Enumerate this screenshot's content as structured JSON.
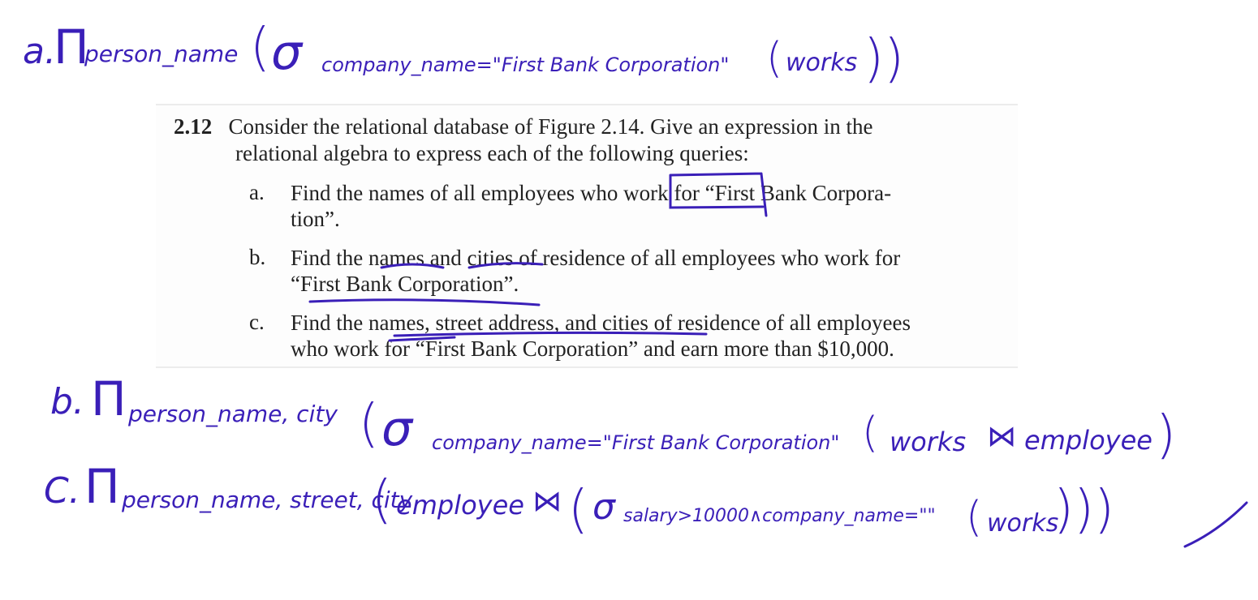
{
  "problem": {
    "number": "2.12",
    "intro_line1": "Consider the relational database of Figure 2.14. Give an expression in the",
    "intro_line2": "relational algebra to express each of the following queries:",
    "items": [
      {
        "letter": "a.",
        "line1": "Find the names of all employees who work for “First Bank Corpora-",
        "line2": "tion”."
      },
      {
        "letter": "b.",
        "line1": "Find the names and cities of residence of all employees who work for",
        "line2": "“First Bank Corporation”."
      },
      {
        "letter": "c.",
        "line1": "Find the names, street address, and cities of residence of all employees",
        "line2": "who work for “First Bank Corporation” and earn more than $10,000."
      }
    ]
  },
  "handwritten": {
    "a": {
      "label": "a.",
      "pi": "Π",
      "pi_sub": "person_name",
      "sigma": "σ",
      "sigma_sub": "company_name=\"First Bank Corporation\"",
      "relation": "works"
    },
    "b": {
      "label": "b.",
      "pi": "Π",
      "pi_sub": "person_name, city",
      "sigma": "σ",
      "sigma_sub": "company_name=\"First Bank Corporation\"",
      "relation": "works",
      "join": "⋈",
      "relation2": "employee"
    },
    "c": {
      "label": "C.",
      "pi": "Π",
      "pi_sub": "person_name, street, city",
      "relation1": "employee",
      "join": "⋈",
      "sigma": "σ",
      "sigma_sub": "salary>10000∧company_name=\"\"",
      "relation": "works"
    }
  },
  "colors": {
    "ink": "#3a1fb8",
    "text": "#222222"
  }
}
